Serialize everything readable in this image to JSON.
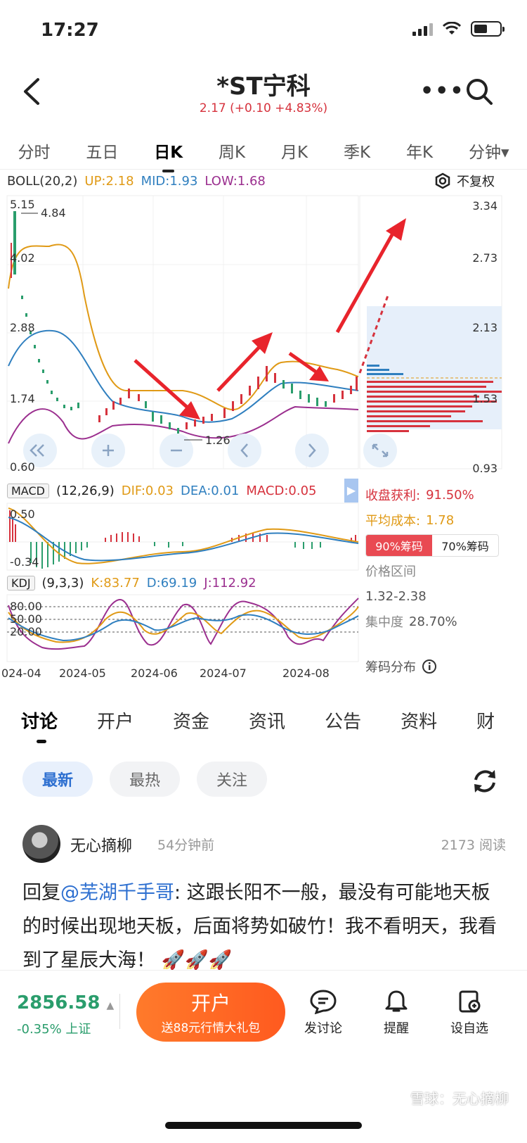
{
  "status": {
    "time": "17:27"
  },
  "header": {
    "title": "*ST宁科",
    "subtitle": "2.17 (+0.10 +4.83%)"
  },
  "period_tabs": [
    "分时",
    "五日",
    "日K",
    "周K",
    "月K",
    "季K",
    "年K",
    "分钟▾"
  ],
  "active_period": "日K",
  "boll": {
    "name": "BOLL(20,2)",
    "up": "UP:2.18",
    "mid": "MID:1.93",
    "low": "LOW:1.68",
    "adjust_label": "不复权"
  },
  "price_axis": [
    "3.34",
    "2.73",
    "2.13",
    "1.53",
    "0.93"
  ],
  "price_labels_left": [
    "5.15",
    "4.02",
    "2.88",
    "1.74",
    "0.60"
  ],
  "annotations": {
    "high": "4.84",
    "low": "1.26"
  },
  "macd": {
    "name": "MACD",
    "params": "(12,26,9)",
    "dif": "DIF:0.03",
    "dea": "DEA:0.01",
    "macd": "MACD:0.05",
    "axis": [
      "0.50",
      "-0.34"
    ]
  },
  "kdj": {
    "name": "KDJ",
    "params": "(9,3,3)",
    "k": "K:83.77",
    "d": "D:69.19",
    "j": "J:112.92",
    "axis": [
      "80.00",
      "50.00",
      "20.00"
    ]
  },
  "date_axis": [
    "024-04",
    "2024-05",
    "2024-06",
    "2024-07",
    "2024-08"
  ],
  "side_panel": {
    "profit_label": "收盘获利:",
    "profit_value": "91.50%",
    "cost_label": "平均成本:",
    "cost_value": "1.78",
    "chip90": "90%筹码",
    "chip70": "70%筹码",
    "range_label": "价格区间",
    "range_value": "1.32-2.38",
    "concentration_label": "集中度",
    "concentration_value": "28.70%",
    "distribution_label": "筹码分布"
  },
  "content_tabs": [
    "讨论",
    "开户",
    "资金",
    "资讯",
    "公告",
    "资料",
    "财"
  ],
  "filters": [
    "最新",
    "最热",
    "关注"
  ],
  "post": {
    "author": "无心摘柳",
    "time": "54分钟前",
    "reads": "2173 阅读",
    "reply_prefix": "回复",
    "mention": "@芜湖千手哥",
    "text": ": 这跟长阳不一般，最没有可能地天板的时候出现地天板，后面将势如破竹！我不看明天，我看到了星辰大海！",
    "emoji": "🚀🚀🚀"
  },
  "bottom_bar": {
    "index_value": "2856.58",
    "index_change": "-0.35% 上证",
    "open_label": "开户",
    "open_sub": "送88元行情大礼包",
    "post_label": "发讨论",
    "alert_label": "提醒",
    "watch_label": "设自选"
  },
  "watermark": "雪球：无心摘柳",
  "colors": {
    "up": "#d6323d",
    "down": "#2a9d6c",
    "boll_up": "#e09a16",
    "boll_mid": "#2f7fbf",
    "boll_low": "#9b2f8f"
  },
  "chart_data": {
    "type": "candlestick",
    "series": [
      {
        "name": "UP",
        "values": [
          2.18
        ]
      },
      {
        "name": "MID",
        "values": [
          1.93
        ]
      },
      {
        "name": "LOW",
        "values": [
          1.68
        ]
      }
    ],
    "x": [
      "024-04",
      "2024-05",
      "2024-06",
      "2024-07",
      "2024-08"
    ],
    "ylim": [
      0.6,
      5.15
    ]
  }
}
